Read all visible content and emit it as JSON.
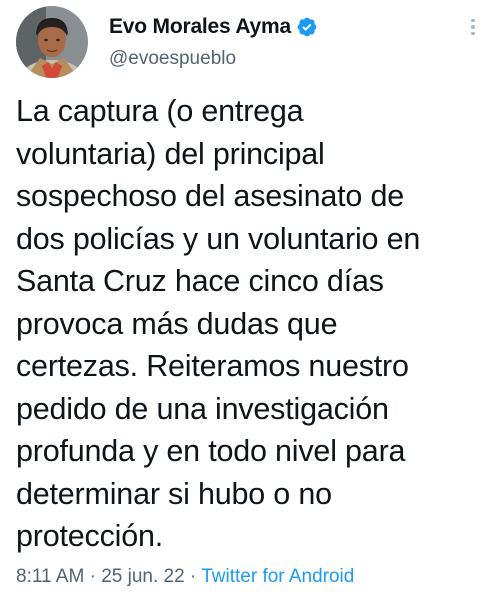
{
  "author": {
    "display_name": "Evo Morales Ayma",
    "handle": "@evoespueblo",
    "verified": true
  },
  "tweet": {
    "text": "La captura (o entrega\nvoluntaria) del principal\nsospechoso del asesinato de\ndos policías y un voluntario en\nSanta Cruz hace cinco días\nprovoca más dudas que\ncertezas. Reiteramos nuestro\npedido de una investigación\nprofunda y en todo nivel para\ndeterminar si hubo o no\nprotección.",
    "time": "8:11 AM",
    "date": "25 jun. 22",
    "separator": "·",
    "source": "Twitter for Android"
  },
  "icons": {
    "verified": "verified-badge-icon",
    "more": "more-options-icon"
  },
  "colors": {
    "text": "#0f1419",
    "secondary": "#536471",
    "link": "#1d9bf0",
    "verified": "#1d9bf0"
  }
}
